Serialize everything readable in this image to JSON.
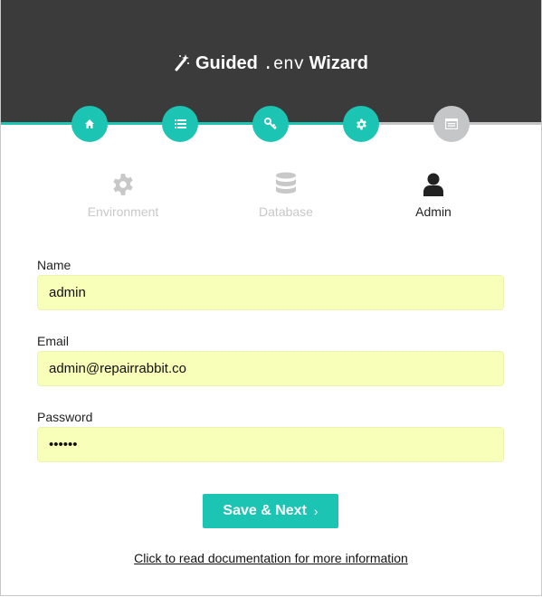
{
  "header": {
    "title_before": "Guided",
    "title_code": ".env",
    "title_after": "Wizard"
  },
  "progress": {
    "steps": [
      {
        "icon": "home-icon",
        "state": "complete"
      },
      {
        "icon": "list-icon",
        "state": "complete"
      },
      {
        "icon": "key-icon",
        "state": "complete"
      },
      {
        "icon": "gear-icon",
        "state": "complete"
      },
      {
        "icon": "terminal-icon",
        "state": "pending"
      }
    ],
    "complete_color": "#1cc4b4",
    "pending_color": "#c4c6c8"
  },
  "tabs": [
    {
      "label": "Environment",
      "icon": "gear-icon",
      "active": false
    },
    {
      "label": "Database",
      "icon": "database-icon",
      "active": false
    },
    {
      "label": "Admin",
      "icon": "user-icon",
      "active": true
    }
  ],
  "form": {
    "name": {
      "label": "Name",
      "value": "admin"
    },
    "email": {
      "label": "Email",
      "value": "admin@repairrabbit.co"
    },
    "password": {
      "label": "Password",
      "value": "••••••"
    }
  },
  "actions": {
    "save_label": "Save & Next",
    "doc_link": "Click to read documentation for more information"
  },
  "colors": {
    "accent": "#1cc4b4",
    "header_bg": "#3b3b3b",
    "input_bg": "#f8ffb8",
    "inactive_tab": "#c8c8c8",
    "active_tab": "#222222"
  }
}
